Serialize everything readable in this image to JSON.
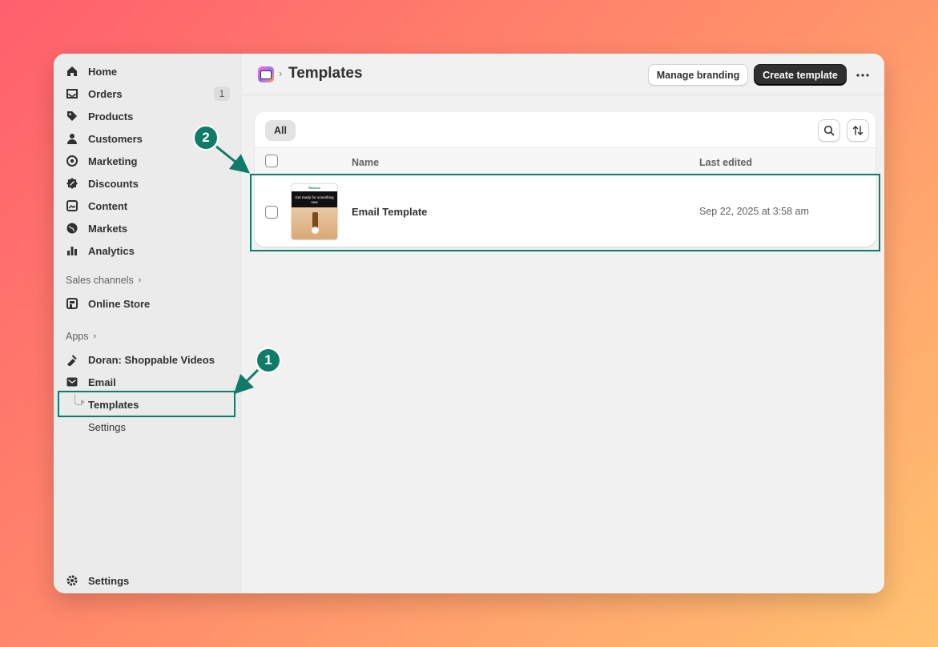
{
  "sidebar": {
    "items": [
      {
        "label": "Home",
        "icon": "home-icon"
      },
      {
        "label": "Orders",
        "icon": "inbox-icon",
        "badge": "1"
      },
      {
        "label": "Products",
        "icon": "tag-icon"
      },
      {
        "label": "Customers",
        "icon": "person-icon"
      },
      {
        "label": "Marketing",
        "icon": "target-icon"
      },
      {
        "label": "Discounts",
        "icon": "discount-icon"
      },
      {
        "label": "Content",
        "icon": "image-icon"
      },
      {
        "label": "Markets",
        "icon": "globe-icon"
      },
      {
        "label": "Analytics",
        "icon": "bar-chart-icon"
      }
    ],
    "sales_channels_label": "Sales channels",
    "online_store_label": "Online Store",
    "apps_label": "Apps",
    "app_doran_label": "Doran: Shoppable Videos",
    "app_email_label": "Email",
    "sub_templates_label": "Templates",
    "sub_settings_label": "Settings",
    "settings_label": "Settings"
  },
  "header": {
    "title": "Templates",
    "manage_branding_label": "Manage branding",
    "create_template_label": "Create template"
  },
  "card": {
    "tab_all_label": "All",
    "columns": {
      "name": "Name",
      "last_edited": "Last edited"
    },
    "rows": [
      {
        "name": "Email Template",
        "last_edited": "Sep 22, 2025 at 3:58 am",
        "thumb_top": "Rebrew",
        "thumb_banner": "Get ready for something new"
      }
    ]
  },
  "annotations": {
    "step1": "1",
    "step2": "2"
  },
  "colors": {
    "accent": "#0f7b68",
    "primary_button": "#303030"
  }
}
